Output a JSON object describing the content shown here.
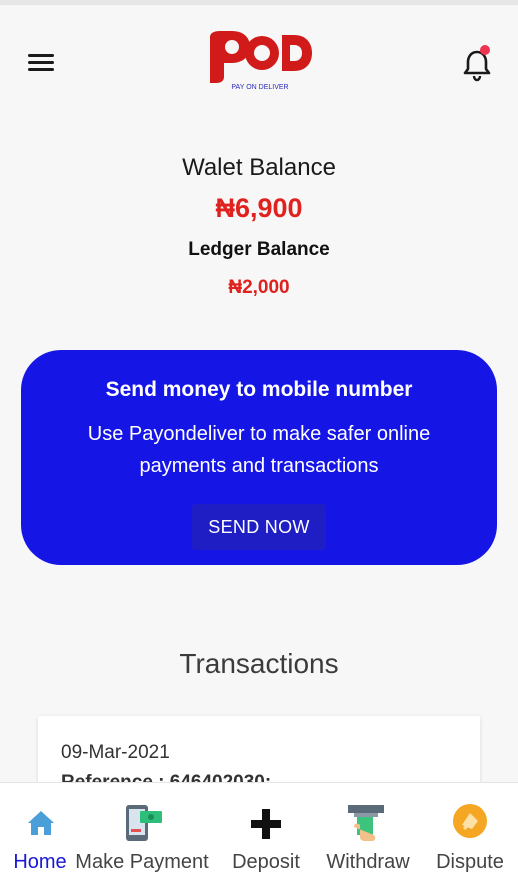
{
  "header": {
    "logo_text": "POD",
    "logo_tagline": "PAY ON DELIVER",
    "icons": [
      "menu-icon",
      "bell-icon"
    ],
    "notification_dot_color": "#f0334f"
  },
  "balance": {
    "wallet_title": "Walet Balance",
    "wallet_amount": "₦6,900",
    "ledger_title": "Ledger Balance",
    "ledger_amount": "₦2,000"
  },
  "promo": {
    "title": "Send money to mobile number",
    "text": "Use Payondeliver to make safer online payments and transactions",
    "button_label": "SEND NOW",
    "bg_color": "#1515e6"
  },
  "transactions": {
    "heading": "Transactions",
    "items": [
      {
        "date": "09-Mar-2021",
        "reference": "Reference : 646402030:"
      }
    ]
  },
  "bottom_nav": {
    "active_color": "#1a17d6",
    "items": [
      {
        "label": "Home",
        "icon": "home-icon",
        "active": true
      },
      {
        "label": "Make Payment",
        "icon": "payment-phone-icon",
        "active": false
      },
      {
        "label": "Deposit",
        "icon": "plus-icon",
        "active": false
      },
      {
        "label": "Withdraw",
        "icon": "atm-withdraw-icon",
        "active": false
      },
      {
        "label": "Dispute",
        "icon": "dispute-icon",
        "active": false
      }
    ]
  }
}
